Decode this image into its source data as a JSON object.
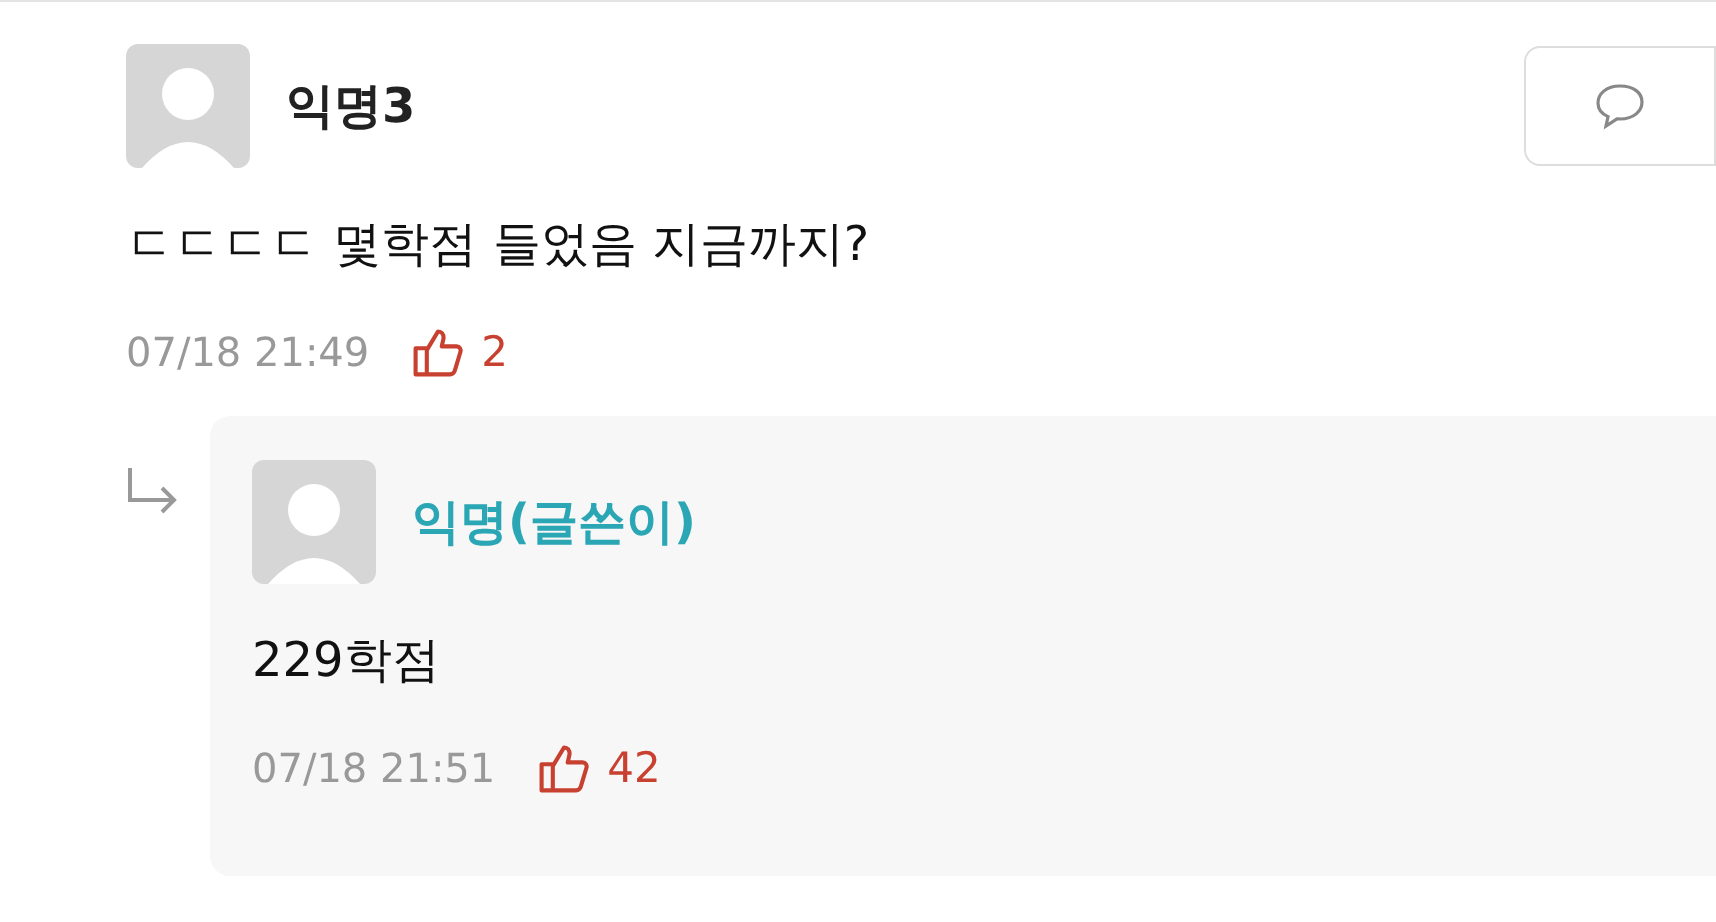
{
  "comments": [
    {
      "kind": "comment",
      "author": "익명3",
      "is_writer": false,
      "text": "ㄷㄷㄷㄷ 몇학점 들었음 지금까지?",
      "time": "07/18 21:49",
      "likes": "2"
    },
    {
      "kind": "reply",
      "author": "익명(글쓴이)",
      "is_writer": true,
      "text": "229학점",
      "time": "07/18 21:51",
      "likes": "42"
    }
  ]
}
